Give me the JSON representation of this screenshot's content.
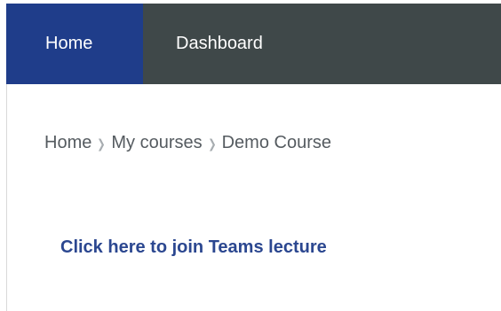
{
  "navbar": {
    "items": [
      {
        "label": "Home",
        "active": true
      },
      {
        "label": "Dashboard",
        "active": false
      }
    ]
  },
  "breadcrumb": {
    "items": [
      "Home",
      "My courses",
      "Demo Course"
    ],
    "separator_icon": "chevron-right-icon"
  },
  "content": {
    "teams_link_label": "Click here to join Teams lecture"
  },
  "colors": {
    "navbar_bg": "#3f4849",
    "active_tab_bg": "#1f3d8a",
    "link": "#2b4790",
    "breadcrumb_text": "#555b60"
  }
}
